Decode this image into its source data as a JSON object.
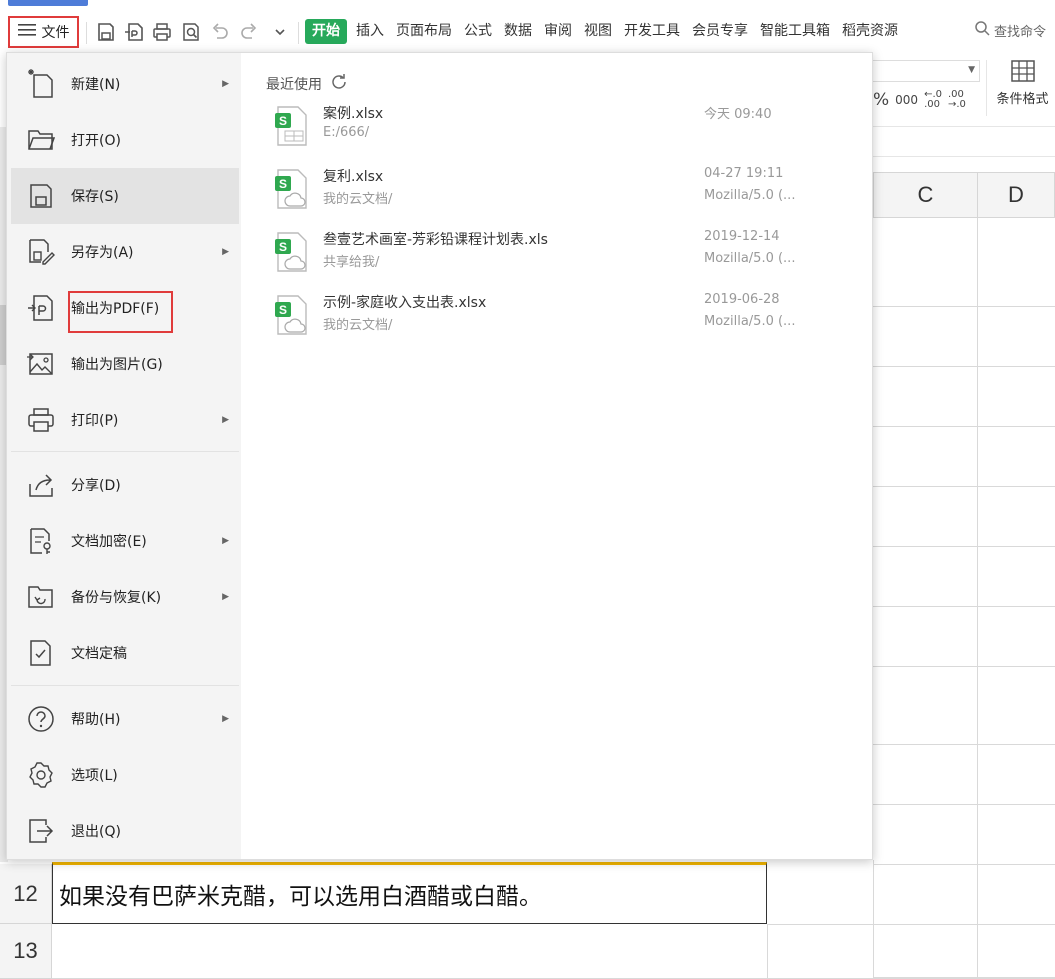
{
  "toolbar": {
    "file_label": "文件",
    "start_tab": "开始",
    "tabs": [
      "插入",
      "页面布局",
      "公式",
      "数据",
      "审阅",
      "视图",
      "开发工具",
      "会员专享",
      "智能工具箱",
      "稻壳资源"
    ],
    "search_label": "查找命令"
  },
  "ribbon": {
    "cond_format_label": "条件格式",
    "format_symbols": [
      "%",
      "000",
      "←.0\n.00",
      ".00\n→.0"
    ]
  },
  "sheet": {
    "columns": [
      "C",
      "D"
    ],
    "rows": [
      {
        "num": "12",
        "text": "如果没有巴萨米克醋，可以选用白酒醋或白醋。"
      },
      {
        "num": "13",
        "text": ""
      }
    ]
  },
  "menu": {
    "items": [
      {
        "label": "新建(N)",
        "icon": "new-file-icon",
        "arrow": true
      },
      {
        "label": "打开(O)",
        "icon": "folder-open-icon",
        "arrow": false
      },
      {
        "label": "保存(S)",
        "icon": "save-icon",
        "arrow": false,
        "selected": true
      },
      {
        "label": "另存为(A)",
        "icon": "save-as-icon",
        "arrow": true
      },
      {
        "label": "输出为PDF(F)",
        "icon": "pdf-export-icon",
        "arrow": false,
        "highlighted": true
      },
      {
        "label": "输出为图片(G)",
        "icon": "image-export-icon",
        "arrow": false
      },
      {
        "label": "打印(P)",
        "icon": "print-icon",
        "arrow": true
      },
      {
        "label": "分享(D)",
        "icon": "share-icon",
        "arrow": false
      },
      {
        "label": "文档加密(E)",
        "icon": "encrypt-icon",
        "arrow": true
      },
      {
        "label": "备份与恢复(K)",
        "icon": "backup-icon",
        "arrow": true
      },
      {
        "label": "文档定稿",
        "icon": "finalize-icon",
        "arrow": false
      },
      {
        "label": "帮助(H)",
        "icon": "help-icon",
        "arrow": true
      },
      {
        "label": "选项(L)",
        "icon": "settings-gear-icon",
        "arrow": false
      },
      {
        "label": "退出(Q)",
        "icon": "exit-icon",
        "arrow": false
      }
    ],
    "recent_title": "最近使用",
    "recent": [
      {
        "name": "案例.xlsx",
        "path": "E:/666/",
        "time": "今天  09:40",
        "device": ""
      },
      {
        "name": "复利.xlsx",
        "path": "我的云文档/",
        "time": "04-27 19:11",
        "device": "Mozilla/5.0 (..."
      },
      {
        "name": "叁壹艺术画室-芳彩铅课程计划表.xls",
        "path": "共享给我/",
        "time": "2019-12-14",
        "device": "Mozilla/5.0 (..."
      },
      {
        "name": "示例-家庭收入支出表.xlsx",
        "path": "我的云文档/",
        "time": "2019-06-28",
        "device": "Mozilla/5.0 (..."
      }
    ]
  },
  "colors": {
    "accent_green": "#27a95b",
    "highlight_red": "#e03b3b",
    "active_cell_top": "#f0b400"
  }
}
